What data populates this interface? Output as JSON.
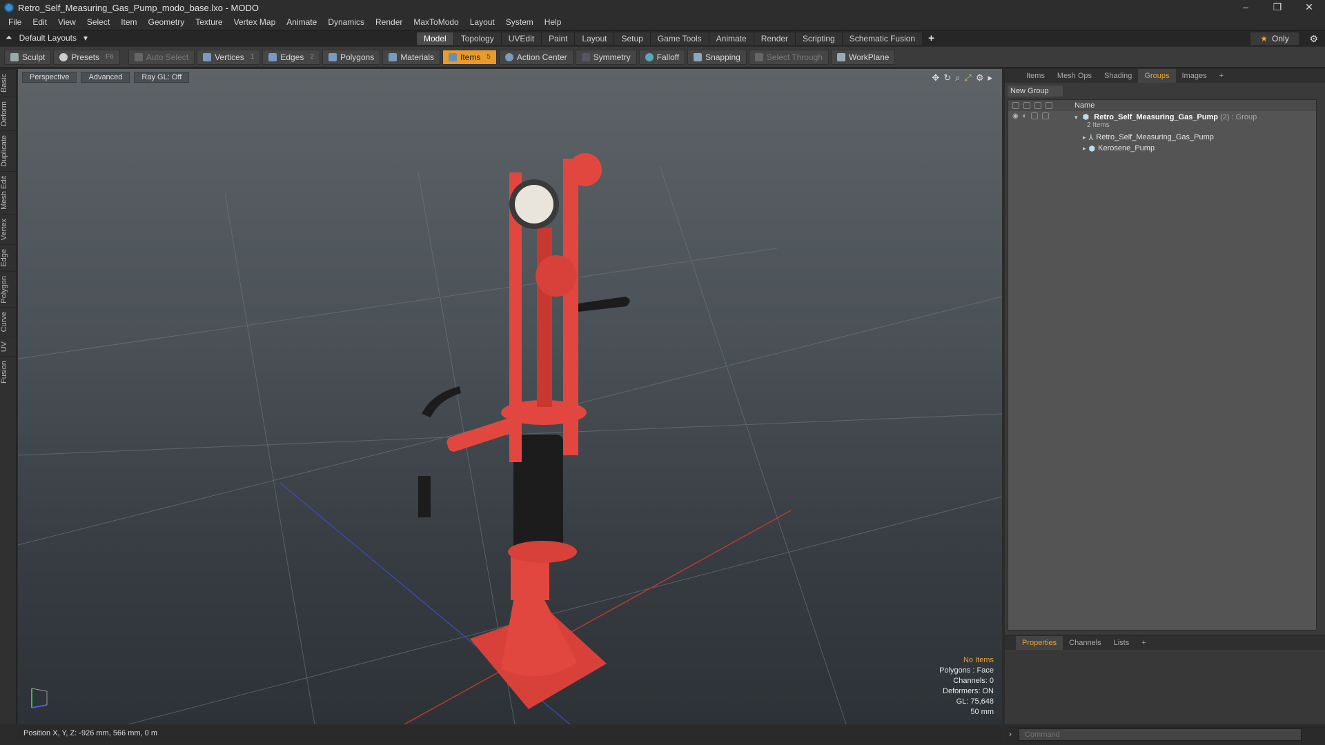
{
  "window": {
    "title": "Retro_Self_Measuring_Gas_Pump_modo_base.lxo - MODO",
    "controls": [
      "–",
      "❐",
      "✕"
    ]
  },
  "menu": [
    "File",
    "Edit",
    "View",
    "Select",
    "Item",
    "Geometry",
    "Texture",
    "Vertex Map",
    "Animate",
    "Dynamics",
    "Render",
    "MaxToModo",
    "Layout",
    "System",
    "Help"
  ],
  "layout": {
    "name": "Default Layouts",
    "tabs": [
      "Model",
      "Topology",
      "UVEdit",
      "Paint",
      "Layout",
      "Setup",
      "Game Tools",
      "Animate",
      "Render",
      "Scripting",
      "Schematic Fusion"
    ],
    "active_tab": "Model",
    "add": "+",
    "only": "Only"
  },
  "toolbar": {
    "sculpt": "Sculpt",
    "presets": "Presets",
    "presets_key": "F6",
    "auto_select": "Auto Select",
    "vertices": "Vertices",
    "vertices_key": "1",
    "edges": "Edges",
    "edges_key": "2",
    "polygons": "Polygons",
    "materials": "Materials",
    "items": "Items",
    "items_key": "5",
    "action_center": "Action Center",
    "symmetry": "Symmetry",
    "falloff": "Falloff",
    "snapping": "Snapping",
    "select_through": "Select Through",
    "workplane": "WorkPlane"
  },
  "left_tabs": [
    "Basic",
    "Deform",
    "Duplicate",
    "Mesh Edit",
    "Vertex",
    "Edge",
    "Polygon",
    "Curve",
    "UV",
    "Fusion"
  ],
  "viewport": {
    "view": "Perspective",
    "shading": "Advanced",
    "raygl": "Ray GL: Off",
    "info": {
      "items": "No Items",
      "polygons": "Polygons : Face",
      "channels": "Channels: 0",
      "deformers": "Deformers: ON",
      "gl": "GL: 75,648",
      "scale": "50 mm"
    }
  },
  "status": {
    "position": "Position X, Y, Z:  -926 mm, 566 mm, 0 m"
  },
  "right_panel": {
    "tabs": [
      "Items",
      "Mesh Ops",
      "Shading",
      "Groups",
      "Images",
      "+"
    ],
    "active_tab": "Groups",
    "new_group": "New Group",
    "column_name": "Name",
    "group": {
      "name": "Retro_Self_Measuring_Gas_Pump",
      "meta": "(2) : Group",
      "sub": "2 Items"
    },
    "children": [
      "Retro_Self_Measuring_Gas_Pump",
      "Kerosene_Pump"
    ]
  },
  "properties": {
    "tabs": [
      "Properties",
      "Channels",
      "Lists",
      "+"
    ],
    "active_tab": "Properties"
  },
  "command": {
    "placeholder": "Command"
  },
  "colors": {
    "accent": "#e89a2c",
    "pump_red": "#e2473f"
  }
}
